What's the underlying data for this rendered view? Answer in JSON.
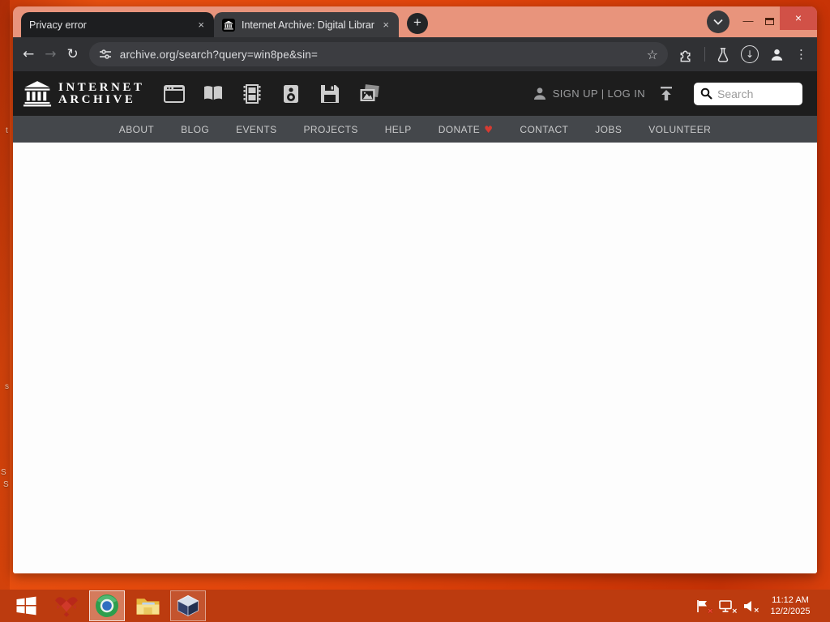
{
  "browser": {
    "tabs": [
      {
        "title": "Privacy error"
      },
      {
        "title": "Internet Archive: Digital Library"
      }
    ],
    "url": "archive.org/search?query=win8pe&sin="
  },
  "site": {
    "logo": {
      "line1": "INTERNET",
      "line2": "ARCHIVE"
    },
    "auth_text": "SIGN UP | LOG IN",
    "search_placeholder": "Search",
    "nav": [
      "ABOUT",
      "BLOG",
      "EVENTS",
      "PROJECTS",
      "HELP",
      "DONATE",
      "CONTACT",
      "JOBS",
      "VOLUNTEER"
    ]
  },
  "taskbar": {
    "time": "11:12 AM",
    "date": "12/2/2025"
  },
  "desktop": {
    "label_fragments": [
      "t",
      "s",
      "S",
      "S"
    ]
  },
  "icons": {
    "close_glyph": "×",
    "plus_glyph": "+",
    "back_glyph": "←",
    "forward_glyph": "→",
    "reload_glyph": "↻",
    "star_glyph": "☆",
    "kebab_glyph": "⋮",
    "minimize_glyph": "—",
    "heart_glyph": "♥",
    "download_arrow_glyph": "↓",
    "mute_glyph": "×",
    "alert_glyph": "×",
    "net_error_glyph": "×"
  },
  "colors": {
    "desktop_orange": "#d84107",
    "taskbar_red": "#bc3b0f",
    "window_frame_salmon": "#e8947c",
    "tab_inactive": "#1d1e20",
    "tab_active": "#3a3b3e",
    "toolbar_dark": "#303134",
    "site_header_black": "#1d1d1d",
    "site_nav_gray": "#44474b",
    "donate_heart_red": "#d63b32",
    "close_button_red": "#d15147"
  }
}
